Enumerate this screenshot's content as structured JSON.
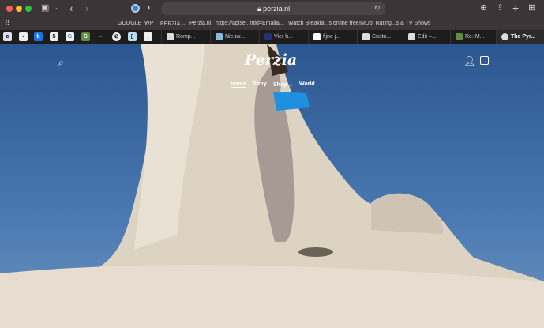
{
  "browser": {
    "url": "perzia.nl",
    "bookmarks": [
      "GOOGLE",
      "WP",
      "PERZIA ⌄",
      "Perzia.nl",
      "https://apise...ntid=Email&...",
      "Watch Breakfa...s online free",
      "IMDb: Rating...s & TV Shows"
    ],
    "pinned_tabs": [
      "c",
      "▪",
      "b",
      "$",
      "G",
      "S",
      "⌣",
      "⊘",
      "▯",
      "!"
    ],
    "tabs": [
      "Romp...",
      "Nieuw...",
      "Vier h...",
      "fijne j...",
      "Custo...",
      "Edit –...",
      "Re: M...",
      "The Pyr..."
    ]
  },
  "site": {
    "logo": "Perzia",
    "nav": [
      "Home",
      "Story",
      "Shop",
      "World"
    ]
  }
}
